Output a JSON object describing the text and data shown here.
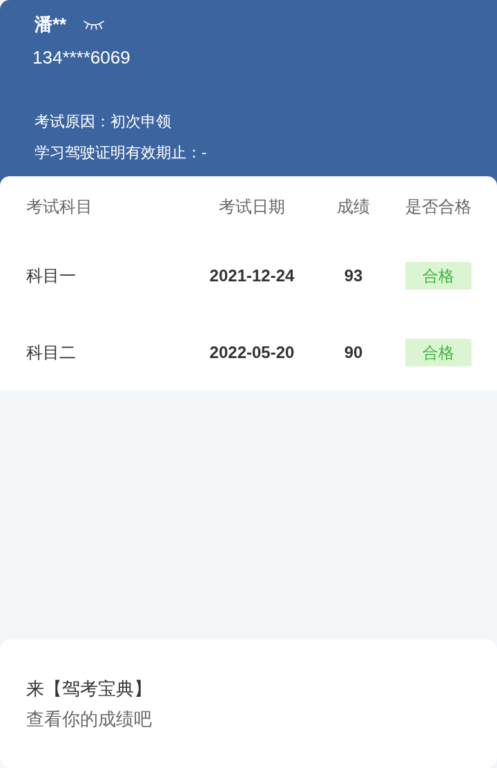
{
  "profile": {
    "name": "潘**",
    "phone": "134****6069",
    "details": [
      "考试原因：初次申领",
      "学习驾驶证明有效期止：-"
    ]
  },
  "table": {
    "columns": [
      "考试科目",
      "考试日期",
      "成绩",
      "是否合格"
    ],
    "rows": [
      {
        "subject": "科目一",
        "date": "2021-12-24",
        "score": "93",
        "result": "合格"
      },
      {
        "subject": "科目二",
        "date": "2022-05-20",
        "score": "90",
        "result": "合格"
      }
    ]
  },
  "promo": {
    "title": "来【驾考宝典】",
    "subtitle": "查看你的成绩吧"
  }
}
